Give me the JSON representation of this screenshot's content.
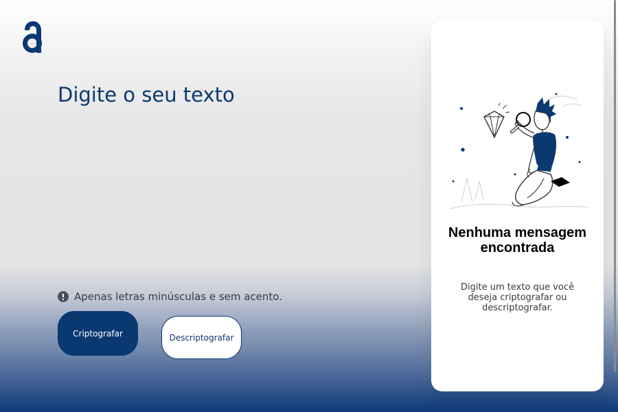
{
  "brand": {
    "logo_icon": "alura-a-logo",
    "accent_color": "#0a3871"
  },
  "input": {
    "placeholder": "Digite o seu texto",
    "value": ""
  },
  "hint": {
    "icon": "exclamation-circle-icon",
    "text": "Apenas letras minúsculas e sem acento."
  },
  "buttons": {
    "encrypt_label": "Criptografar",
    "decrypt_label": "Descriptografar"
  },
  "output": {
    "illustration": "person-with-magnifying-glass-and-diamond",
    "title": "Nenhuma mensagem encontrada",
    "message": "Digite um texto que você deseja criptografar ou descriptografar."
  },
  "colors": {
    "primary_dark_blue": "#0a3871",
    "hint_text": "#343a40",
    "panel_background": "#ffffff"
  }
}
